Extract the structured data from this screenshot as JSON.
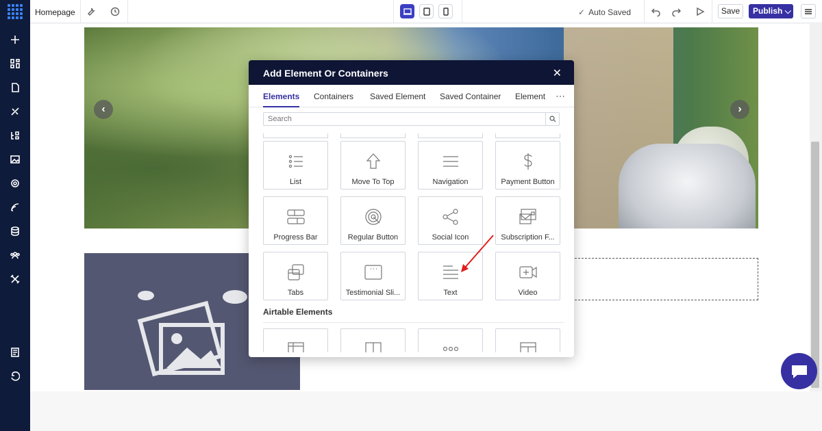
{
  "topbar": {
    "page_name": "Homepage",
    "auto_saved": "Auto Saved",
    "save_label": "Save",
    "publish_label": "Publish"
  },
  "modal": {
    "title": "Add Element Or Containers",
    "close": "✕",
    "tabs": [
      "Elements",
      "Containers",
      "Saved Element",
      "Saved Container",
      "Element S"
    ],
    "more": "⋯",
    "search_placeholder": "Search",
    "tiles": [
      {
        "label": "List",
        "icon": "list-icon"
      },
      {
        "label": "Move To Top",
        "icon": "arrow-up-icon"
      },
      {
        "label": "Navigation",
        "icon": "menu-lines-icon"
      },
      {
        "label": "Payment Button",
        "icon": "dollar-icon"
      },
      {
        "label": "Progress Bar",
        "icon": "progress-bar-icon"
      },
      {
        "label": "Regular Button",
        "icon": "click-target-icon"
      },
      {
        "label": "Social Icon",
        "icon": "share-icon"
      },
      {
        "label": "Subscription F...",
        "icon": "subscription-mail-icon"
      },
      {
        "label": "Tabs",
        "icon": "tabs-icon"
      },
      {
        "label": "Testimonial Sli...",
        "icon": "testimonial-slider-icon"
      },
      {
        "label": "Text",
        "icon": "text-lines-icon"
      },
      {
        "label": "Video",
        "icon": "video-icon"
      }
    ],
    "section_airtable": "Airtable Elements"
  },
  "colors": {
    "sidebar": "#0f1b3a",
    "accent": "#3730a3",
    "modal_header": "#0f1535",
    "arrow": "#e11d1d"
  }
}
